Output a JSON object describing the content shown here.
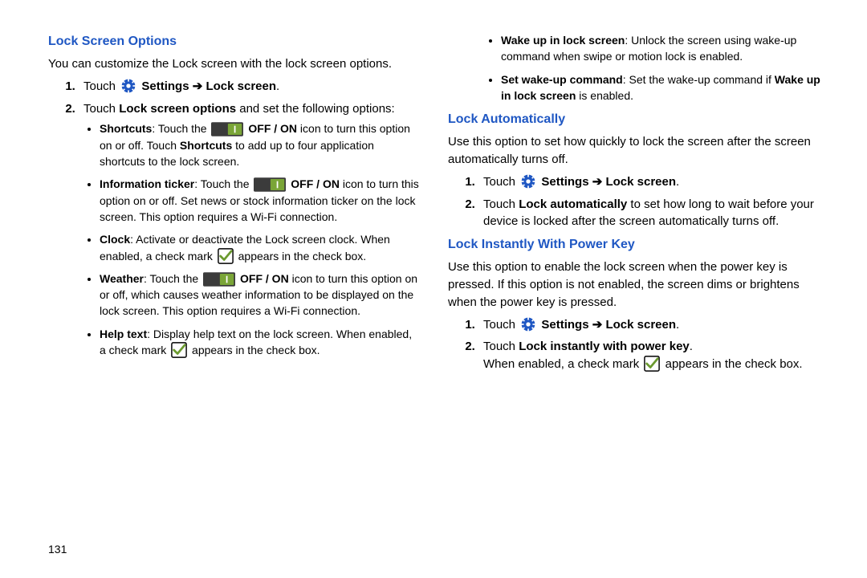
{
  "page_number": "131",
  "arrow": "➔",
  "left": {
    "heading": "Lock Screen Options",
    "intro": "You can customize the Lock screen with the lock screen options.",
    "step1_touch": "Touch",
    "settings": "Settings",
    "lock_screen": "Lock screen",
    "step2_pre": "Touch ",
    "step2_bold": "Lock screen options",
    "step2_post": " and set the following options:",
    "bullets": {
      "shortcuts_label": "Shortcuts",
      "shortcuts_a": ": Touch the ",
      "shortcuts_b": " OFF / ON",
      "shortcuts_c": " icon to turn this option on or off. Touch ",
      "shortcuts_d": "Shortcuts",
      "shortcuts_e": " to add up to four application shortcuts to the lock screen.",
      "info_label": "Information ticker",
      "info_a": ": Touch the ",
      "info_b": " OFF / ON",
      "info_c": " icon to turn this option on or off. Set news or stock information ticker on the lock screen. This option requires a Wi-Fi connection.",
      "clock_label": "Clock",
      "clock_a": ": Activate or deactivate the Lock screen clock. When enabled, a check mark ",
      "clock_b": " appears in the check box.",
      "weather_label": "Weather",
      "weather_a": ": Touch the ",
      "weather_b": " OFF / ON",
      "weather_c": " icon to turn this option on or off, which causes weather information to be displayed on the lock screen. This option requires a Wi-Fi connection.",
      "help_label": "Help text",
      "help_a": ": Display help text on the lock screen. When enabled, a check mark ",
      "help_b": " appears in the check box."
    }
  },
  "right": {
    "top_bullets": {
      "wake_label": "Wake up in lock screen",
      "wake_text": ": Unlock the screen using wake-up command when swipe or motion lock is enabled.",
      "set_label": "Set wake-up command",
      "set_a": ": Set the wake-up command if ",
      "set_b": "Wake up in lock screen",
      "set_c": " is enabled."
    },
    "auto_heading": "Lock Automatically",
    "auto_intro": "Use this option to set how quickly to lock the screen after the screen automatically turns off.",
    "auto_step1_touch": "Touch",
    "auto_step2_a": "Touch ",
    "auto_step2_b": "Lock automatically",
    "auto_step2_c": " to set how long to wait before your device is locked after the screen automatically turns off.",
    "instant_heading": "Lock Instantly With Power Key",
    "instant_intro": "Use this option to enable the lock screen when the power key is pressed. If this option is not enabled, the screen dims or brightens when the power key is pressed.",
    "instant_step1_touch": "Touch",
    "instant_step2_a": "Touch ",
    "instant_step2_b": "Lock instantly with power key",
    "instant_step2_c": ".",
    "instant_step2_d": "When enabled, a check mark ",
    "instant_step2_e": " appears in the check box."
  }
}
